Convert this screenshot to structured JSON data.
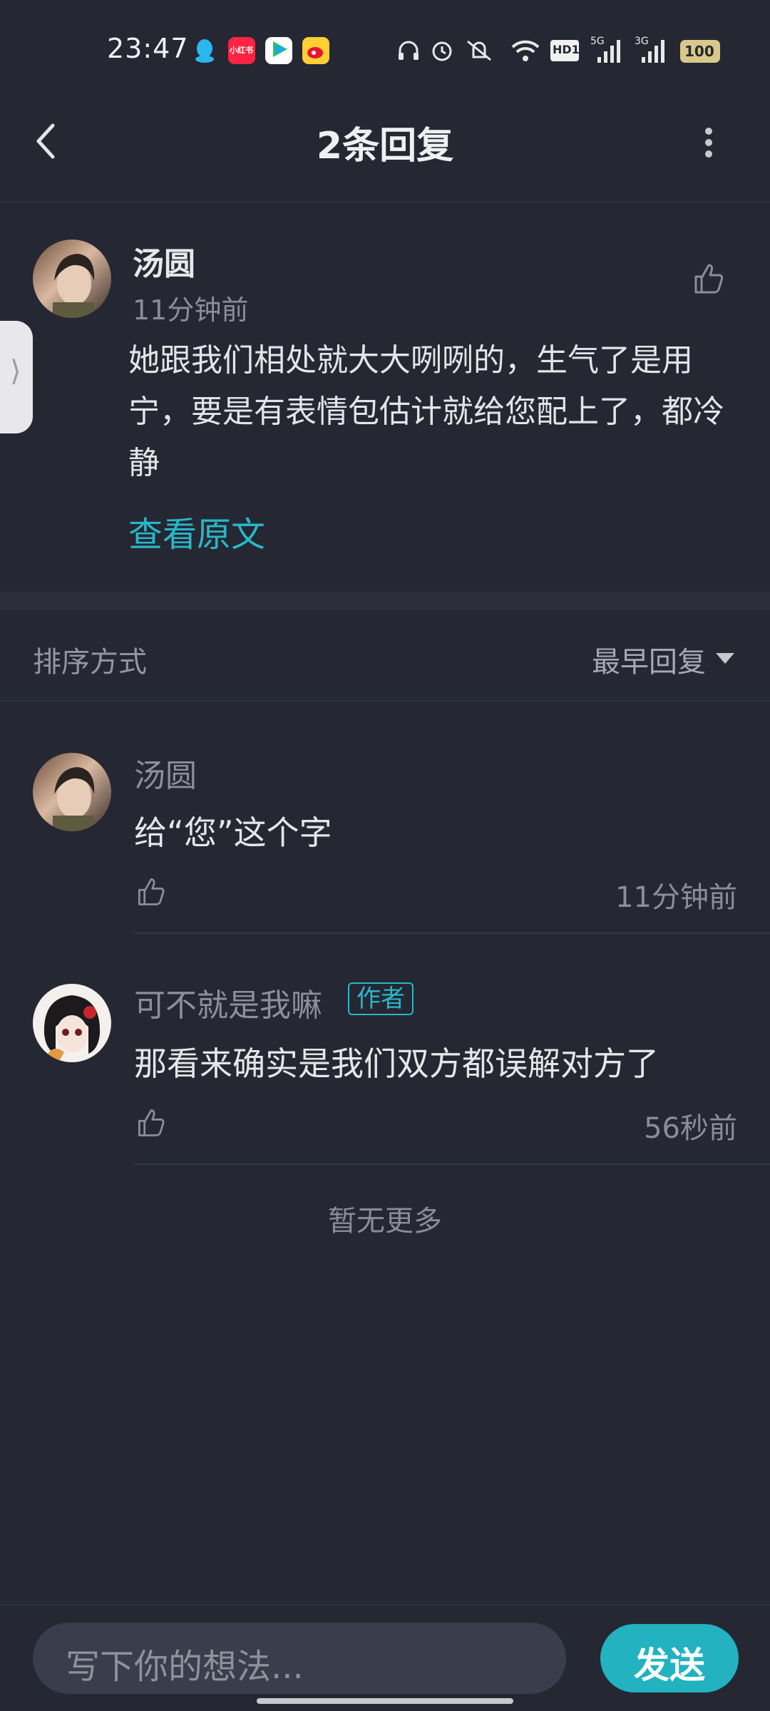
{
  "status_bar": {
    "time": "23:47",
    "apps": [
      "qq-icon",
      "xiaohongshu-icon",
      "tencent-video-icon",
      "weibo-icon"
    ],
    "app_labels": [
      "小红书"
    ],
    "indicators": [
      "headphones-icon",
      "alarm-icon",
      "mute-icon",
      "wifi-icon",
      "hd-icon",
      "signal-5g-icon",
      "signal-3g-icon",
      "battery-icon"
    ],
    "battery": "100",
    "hd": "HD1",
    "net1": "5G",
    "net2": "3G"
  },
  "header": {
    "title": "2条回复"
  },
  "main_comment": {
    "username": "汤圆",
    "time": "11分钟前",
    "text": "她跟我们相处就大大咧咧的，生气了是用宁，要是有表情包估计就给您配上了，都冷静",
    "view_original": "查看原文"
  },
  "sort": {
    "label": "排序方式",
    "value": "最早回复"
  },
  "replies": [
    {
      "username": "汤圆",
      "text": "给“您”这个字",
      "time": "11分钟前",
      "badge": ""
    },
    {
      "username": "可不就是我嘛",
      "badge": "作者",
      "text": "那看来确实是我们双方都误解对方了",
      "time": "56秒前"
    }
  ],
  "footer_note": "暂无更多",
  "composer": {
    "placeholder": "写下你的想法...",
    "send_label": "发送"
  },
  "colors": {
    "background": "#252733",
    "accent": "#27b8c8",
    "send_button": "#22b2c0"
  }
}
